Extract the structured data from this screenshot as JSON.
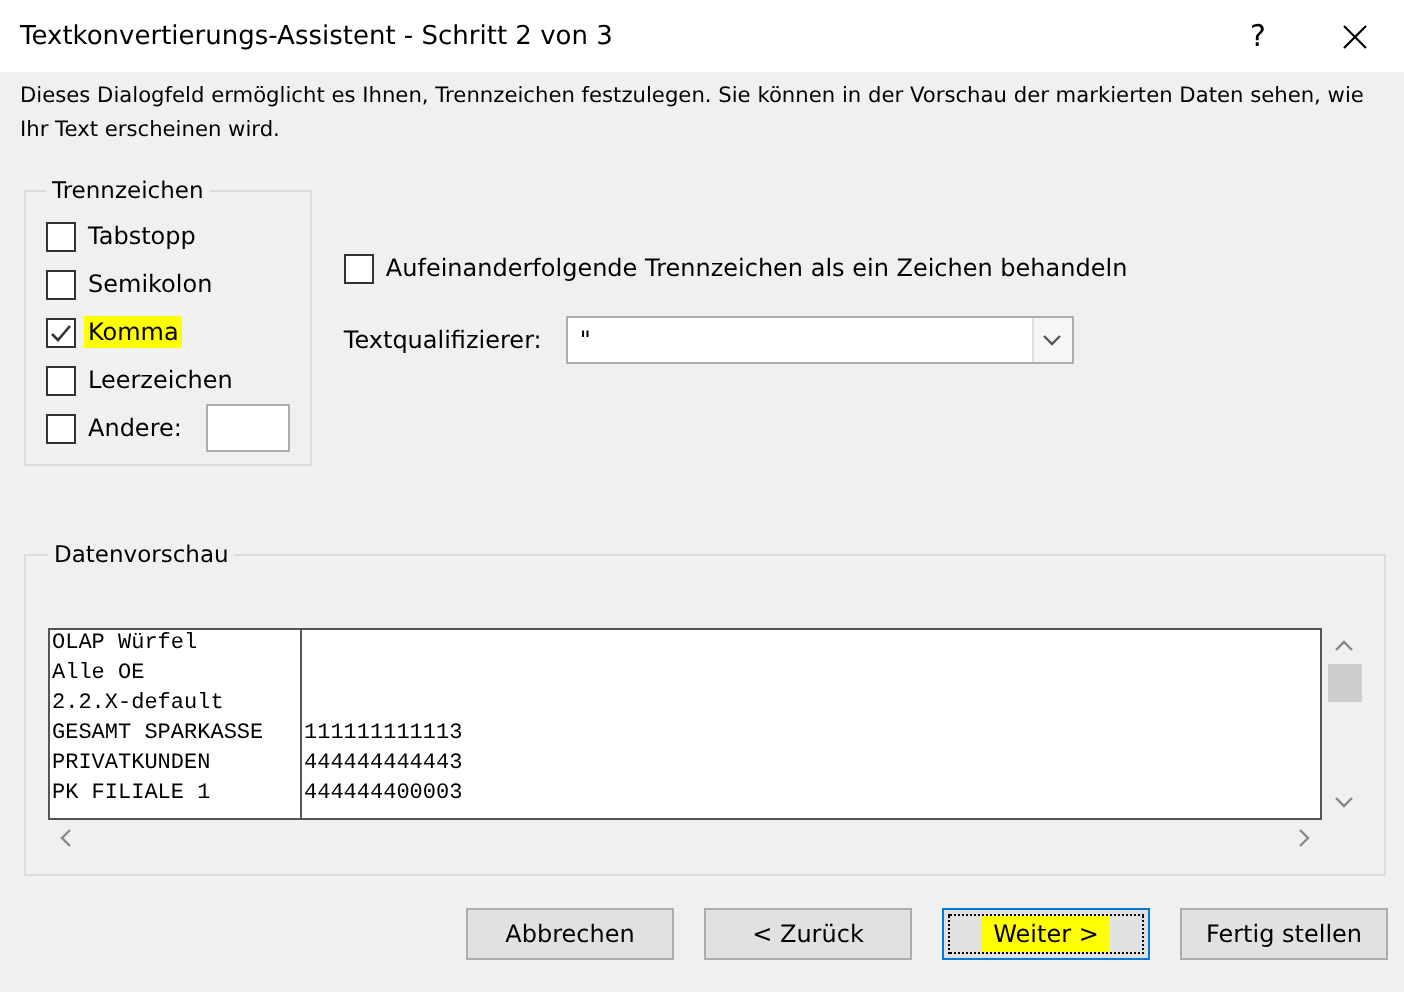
{
  "window": {
    "title": "Textkonvertierungs-Assistent - Schritt 2 von 3",
    "help": "?"
  },
  "description": "Dieses Dialogfeld ermöglicht es Ihnen, Trennzeichen festzulegen. Sie können in der Vorschau der markierten Daten sehen, wie Ihr Text erscheinen wird.",
  "delimiters": {
    "title": "Trennzeichen",
    "items": [
      {
        "label": "Tabstopp",
        "checked": false,
        "highlighted": false
      },
      {
        "label": "Semikolon",
        "checked": false,
        "highlighted": false
      },
      {
        "label": "Komma",
        "checked": true,
        "highlighted": true
      },
      {
        "label": "Leerzeichen",
        "checked": false,
        "highlighted": false
      },
      {
        "label": "Andere:",
        "checked": false,
        "highlighted": false,
        "kind": "other"
      }
    ]
  },
  "consecutive": {
    "label": "Aufeinanderfolgende Trennzeichen als ein Zeichen behandeln",
    "checked": false
  },
  "qualifier": {
    "label": "Textqualifizierer:",
    "value": "\""
  },
  "preview": {
    "title": "Datenvorschau",
    "rows": [
      [
        "OLAP Würfel",
        ""
      ],
      [
        "Alle OE",
        ""
      ],
      [
        "2.2.X-default",
        ""
      ],
      [
        "GESAMT SPARKASSE",
        "111111111113"
      ],
      [
        "PRIVATKUNDEN",
        "444444444443"
      ],
      [
        "PK FILIALE 1",
        "444444400003"
      ]
    ]
  },
  "buttons": [
    {
      "label": "Abbrechen",
      "focused": false,
      "highlighted": false
    },
    {
      "label": "< Zurück",
      "focused": false,
      "highlighted": false
    },
    {
      "label": "Weiter >",
      "focused": true,
      "highlighted": true
    },
    {
      "label": "Fertig stellen",
      "focused": false,
      "highlighted": false
    }
  ]
}
